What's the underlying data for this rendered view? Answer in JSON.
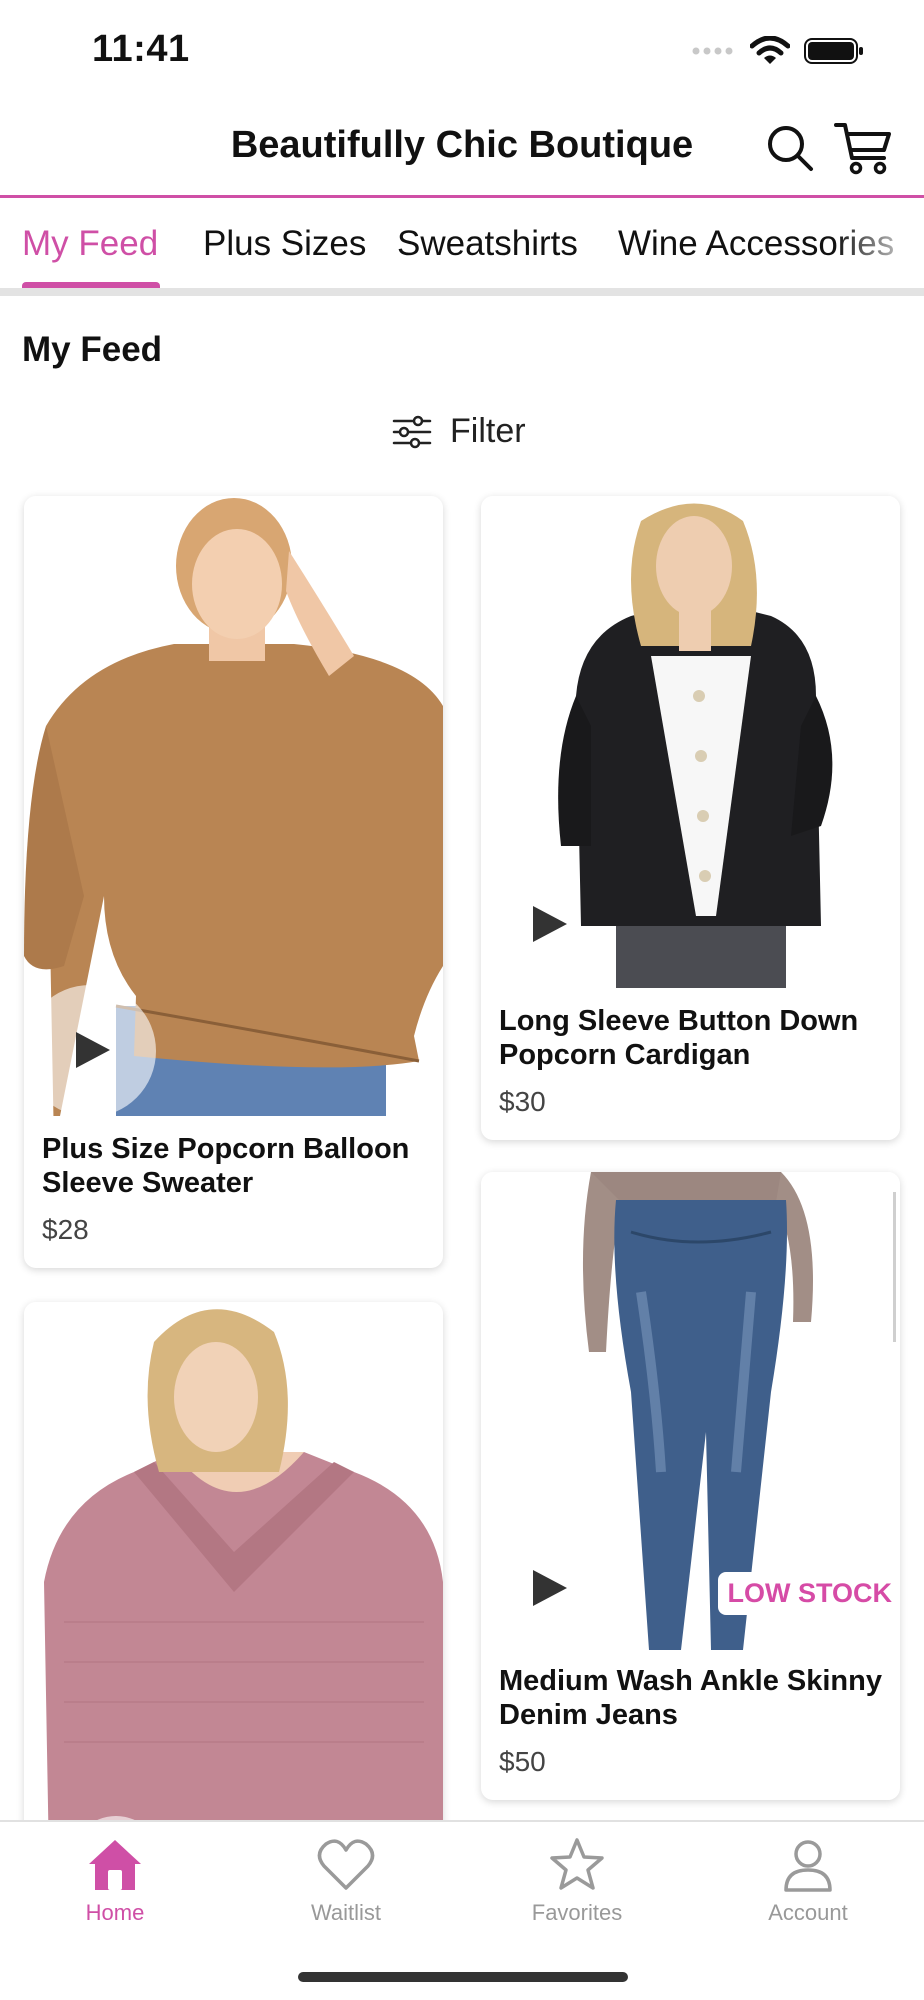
{
  "status_bar": {
    "time": "11:41"
  },
  "header": {
    "title": "Beautifully Chic Boutique"
  },
  "tabs": [
    {
      "label": "My Feed",
      "active": true
    },
    {
      "label": "Plus Sizes",
      "active": false
    },
    {
      "label": "Sweatshirts",
      "active": false
    },
    {
      "label": "Wine Accessories",
      "active": false
    }
  ],
  "feed": {
    "heading": "My Feed",
    "filter_label": "Filter",
    "products": [
      {
        "title": "Plus Size Popcorn Balloon Sleeve Sweater",
        "price": "$28",
        "image": "tan-popcorn-sweater",
        "video": true
      },
      {
        "title": "Long Sleeve Button Down Popcorn Cardigan",
        "price": "$30",
        "image": "black-popcorn-cardigan",
        "video": true
      },
      {
        "title": "Medium Wash Ankle Skinny Denim Jeans",
        "price": "$50",
        "image": "denim-skinny-jeans",
        "video": true,
        "badge": "LOW STOCK"
      },
      {
        "title": "",
        "price": "",
        "image": "pink-waffle-sweater",
        "video": true
      }
    ]
  },
  "bottom_nav": [
    {
      "label": "Home",
      "icon": "home-icon",
      "active": true
    },
    {
      "label": "Waitlist",
      "icon": "heart-icon",
      "active": false
    },
    {
      "label": "Favorites",
      "icon": "star-icon",
      "active": false
    },
    {
      "label": "Account",
      "icon": "person-icon",
      "active": false
    }
  ],
  "colors": {
    "accent": "#cf4fa6",
    "badge": "#d64ba6",
    "muted": "#999999"
  }
}
